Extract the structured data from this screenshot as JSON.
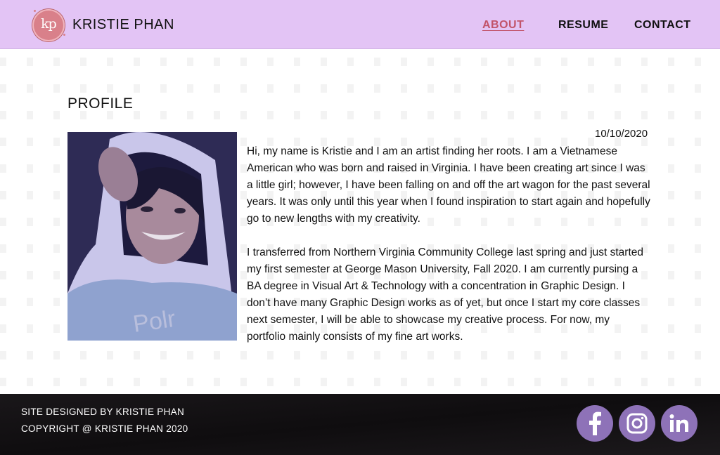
{
  "header": {
    "logo_text": "kp",
    "brand": "KRISTIE PHAN",
    "nav": [
      {
        "label": "ABOUT",
        "active": true
      },
      {
        "label": "RESUME",
        "active": false
      },
      {
        "label": "CONTACT",
        "active": false
      }
    ]
  },
  "main": {
    "title": "PROFILE",
    "date": "10/10/2020",
    "paragraphs": [
      "Hi, my name is Kristie and I am an artist finding her roots. I am a Vietnamese American who was born and raised in Virginia. I have been creating art since I was a little girl; however, I have been falling on and off the art wagon for the past several years. It was only until this year when I found inspiration to start again and hopefully go to new lengths with my creativity.",
      "I transferred from Northern Virginia Community College last spring and just started my first semester at George Mason University, Fall 2020. I am currently pursing a BA degree in Visual Art & Technology with a concentration in Graphic Design. I don’t have many Graphic Design works as of yet, but once I start my core classes next semester, I will be able to showcase my creative process. For now, my portfolio mainly consists of my fine art works."
    ]
  },
  "footer": {
    "line1": "SITE DESIGNED BY KRISTIE PHAN",
    "line2": "COPYRIGHT @ KRISTIE PHAN 2020",
    "social": [
      "facebook-icon",
      "instagram-icon",
      "linkedin-icon"
    ]
  },
  "colors": {
    "header_bg": "#e3c4f5",
    "nav_active": "#c2546a",
    "footer_bg": "#141214",
    "social_bg": "#8e72b8"
  }
}
